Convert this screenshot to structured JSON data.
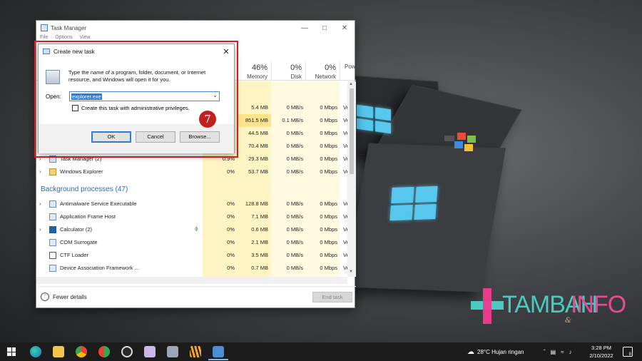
{
  "task_manager": {
    "title": "Task Manager",
    "menu": [
      "File",
      "Options",
      "View"
    ],
    "columns": [
      {
        "pct": "46%",
        "label": "Memory"
      },
      {
        "pct": "0%",
        "label": "Disk"
      },
      {
        "pct": "0%",
        "label": "Network"
      },
      {
        "pct": "",
        "label": "Powe"
      }
    ],
    "apps_rows": [
      {
        "name": "",
        "cpu": "",
        "mem": "5.4 MB",
        "disk": "0 MB/s",
        "net": "0 Mbps",
        "pow": "Ve"
      },
      {
        "name": "",
        "cpu": "",
        "mem": "851.5 MB",
        "disk": "0.1 MB/s",
        "net": "0 Mbps",
        "pow": "Ve"
      },
      {
        "name": "",
        "cpu": "",
        "mem": "44.5 MB",
        "disk": "0 MB/s",
        "net": "0 Mbps",
        "pow": "Ve"
      },
      {
        "name": "",
        "cpu": "",
        "mem": "70.4 MB",
        "disk": "0 MB/s",
        "net": "0 Mbps",
        "pow": "Ve"
      },
      {
        "name": "Task Manager (2)",
        "cpu": "0.9%",
        "mem": "29.3 MB",
        "disk": "0 MB/s",
        "net": "0 Mbps",
        "pow": "Ve"
      },
      {
        "name": "Windows Explorer",
        "cpu": "0%",
        "mem": "53.7 MB",
        "disk": "0 MB/s",
        "net": "0 Mbps",
        "pow": "Ve"
      }
    ],
    "background_header": "Background processes (47)",
    "bg_rows": [
      {
        "name": "Antimalware Service Executable",
        "cpu": "0%",
        "mem": "128.8 MB",
        "disk": "0 MB/s",
        "net": "0 Mbps",
        "pow": "Ve"
      },
      {
        "name": "Application Frame Host",
        "cpu": "0%",
        "mem": "7.1 MB",
        "disk": "0 MB/s",
        "net": "0 Mbps",
        "pow": "Ve"
      },
      {
        "name": "Calculator (2)",
        "cpu": "0%",
        "mem": "0.6 MB",
        "disk": "0 MB/s",
        "net": "0 Mbps",
        "pow": "Ve"
      },
      {
        "name": "COM Surrogate",
        "cpu": "0%",
        "mem": "2.1 MB",
        "disk": "0 MB/s",
        "net": "0 Mbps",
        "pow": "Ve"
      },
      {
        "name": "CTF Loader",
        "cpu": "0%",
        "mem": "3.5 MB",
        "disk": "0 MB/s",
        "net": "0 Mbps",
        "pow": "Ve"
      },
      {
        "name": "Device Association Framework ...",
        "cpu": "0%",
        "mem": "0.7 MB",
        "disk": "0 MB/s",
        "net": "0 Mbps",
        "pow": "Ve"
      }
    ],
    "fewer_details": "Fewer details",
    "end_task": "End task"
  },
  "run_dialog": {
    "title": "Create new task",
    "description": "Type the name of a program, folder, document, or Internet resource, and Windows will open it for you.",
    "open_label": "Open:",
    "open_value": "explorer.exe",
    "admin_checkbox": "Create this task with administrative privileges.",
    "ok": "OK",
    "cancel": "Cancel",
    "browse": "Browse..."
  },
  "step_badge": "7",
  "watermark": {
    "part1": "TAMBAH",
    "part2": "INFO",
    "amp": "&"
  },
  "taskbar": {
    "weather": "28°C  Hujan ringan",
    "time": "3:28 PM",
    "date": "2/10/2022",
    "notifications": "8"
  }
}
